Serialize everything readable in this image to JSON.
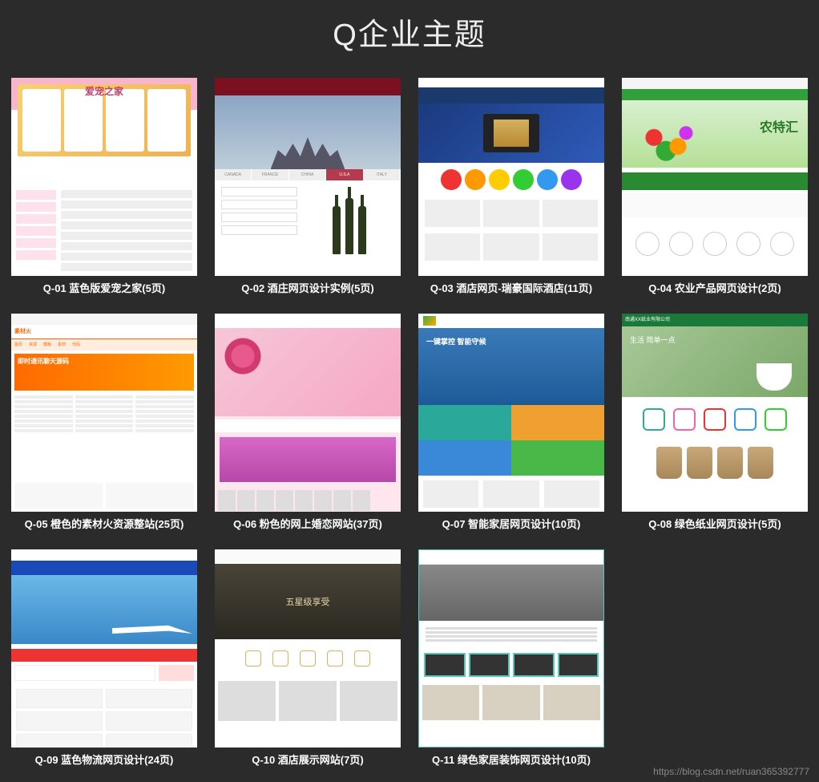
{
  "title": "Q企业主题",
  "watermark": "https://blog.csdn.net/ruan365392777",
  "accent_colors": {
    "q01": "#f7b6cc",
    "q02": "#7a1020",
    "q03": "#1a3a6e",
    "q04": "#32a03a",
    "q05": "#ff6a00",
    "q06": "#e85a8e",
    "q07": "#1e5a98",
    "q08": "#1a7a3a",
    "q09": "#1a4ab8",
    "q10": "#d8b060",
    "q11": "#5ac8b8"
  },
  "cards": [
    {
      "id": "q01",
      "caption": "Q-01 蓝色版爱宠之家(5页)",
      "thumb_title": "爱宠之家"
    },
    {
      "id": "q02",
      "caption": "Q-02 酒庄网页设计实例(5页)",
      "tabs": [
        "CANADA",
        "FRANCE",
        "CHINA",
        "U.S.A",
        "ITALY"
      ],
      "active_tab": 3
    },
    {
      "id": "q03",
      "caption": "Q-03 酒店网页-瑞豪国际酒店(11页)",
      "circle_colors": [
        "#e33",
        "#f90",
        "#fc0",
        "#3c3",
        "#39e",
        "#93e"
      ]
    },
    {
      "id": "q04",
      "caption": "Q-04 农业产品网页设计(2页)",
      "hero_text": "农特汇"
    },
    {
      "id": "q05",
      "caption": "Q-05 橙色的素材火资源整站(25页)",
      "logo_text": "素材火",
      "ad_text": "即时通讯聊天源码"
    },
    {
      "id": "q06",
      "caption": "Q-06 粉色的网上婚恋网站(37页)"
    },
    {
      "id": "q07",
      "caption": "Q-07 智能家居网页设计(10页)",
      "hero_text": "一键掌控 智能守候",
      "tile_colors": [
        "#2aa89a",
        "#f0a030",
        "#3a88d8",
        "#4ab848"
      ]
    },
    {
      "id": "q08",
      "caption": "Q-08 绿色纸业网页设计(5页)",
      "hero_text": "生活 简单一点",
      "icon_colors": [
        "#3a9",
        "#e6a",
        "#e33",
        "#39e",
        "#3c3"
      ]
    },
    {
      "id": "q09",
      "caption": "Q-09 蓝色物流网页设计(24页)"
    },
    {
      "id": "q10",
      "caption": "Q-10 酒店展示网站(7页)",
      "hero_text": "五星级享受"
    },
    {
      "id": "q11",
      "caption": "Q-11 绿色家居装饰网页设计(10页)"
    }
  ]
}
